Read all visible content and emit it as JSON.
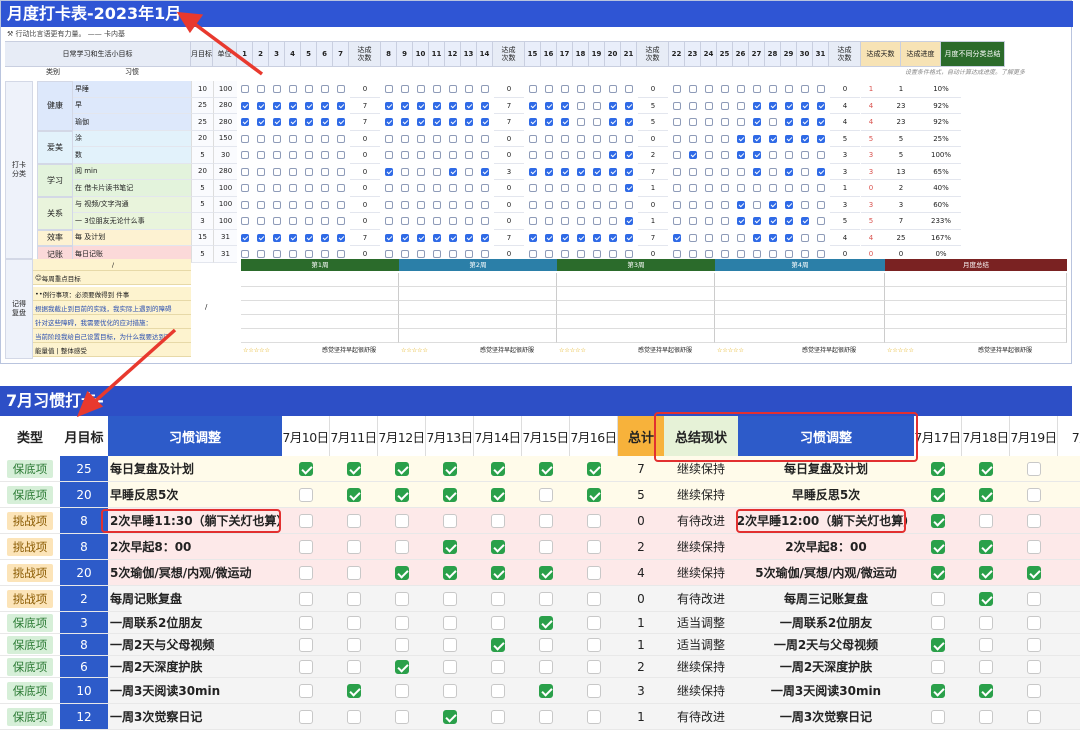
{
  "top": {
    "title": "月度打卡表-2023年1月",
    "quote": "行动比言语更有力量。 —— 卡内基",
    "head": {
      "goal_col": "日常学习和生活小目标",
      "monthly_target": "月目标",
      "done": "单位",
      "reach": "达成\n次数",
      "days_done": "达成天数",
      "progress": "达成进度",
      "summary": "月度不同分类总结"
    },
    "sub": {
      "category": "类别",
      "habit": "习惯",
      "hint": "设置条件格式，自动计算达成进度。了解更多"
    },
    "days": [
      "1",
      "2",
      "3",
      "4",
      "5",
      "6",
      "7",
      "8",
      "9",
      "10",
      "11",
      "12",
      "13",
      "14",
      "15",
      "16",
      "17",
      "18",
      "19",
      "20",
      "21",
      "22",
      "23",
      "24",
      "25",
      "26",
      "27",
      "28",
      "29",
      "30",
      "31"
    ],
    "label_daka": "打卡\n分类",
    "categories": [
      {
        "name": "健康",
        "rows": 3,
        "color": "#dde8fb"
      },
      {
        "name": "爱美",
        "rows": 2,
        "color": "#e2f2fb"
      },
      {
        "name": "学习",
        "rows": 2,
        "color": "#e3f3dc"
      },
      {
        "name": "关系",
        "rows": 2,
        "color": "#e9f4dc"
      },
      {
        "name": "效率",
        "rows": 1,
        "color": "#fdf2d2"
      },
      {
        "name": "记账",
        "rows": 1,
        "color": "#fbd9d9"
      }
    ],
    "rows": [
      {
        "habit": "早睡",
        "n1": "10",
        "n2": "100",
        "w": [
          "0",
          "0",
          "0",
          "0"
        ],
        "r": "1",
        "t": "1",
        "p": "10%",
        "checks": "0000000 0000000 0000000 0000000000"
      },
      {
        "habit": "早",
        "n1": "25",
        "n2": "280",
        "w": [
          "7",
          "7",
          "5",
          "4"
        ],
        "r": "4",
        "t": "23",
        "p": "92%",
        "checks": "1111111 1111111 1110011 0000011111"
      },
      {
        "habit": "瑜伽",
        "n1": "25",
        "n2": "280",
        "w": [
          "7",
          "7",
          "5",
          "4"
        ],
        "r": "4",
        "t": "23",
        "p": "92%",
        "checks": "1111111 1111111 1110011 0000010111"
      },
      {
        "habit": "涂",
        "n1": "20",
        "n2": "150",
        "w": [
          "0",
          "0",
          "0",
          "5"
        ],
        "r": "5",
        "t": "5",
        "p": "25%",
        "checks": "0000000 0000000 0000000 0000111111"
      },
      {
        "habit": "数",
        "n1": "5",
        "n2": "30",
        "w": [
          "0",
          "0",
          "2",
          "3"
        ],
        "r": "3",
        "t": "5",
        "p": "100%",
        "checks": "0000000 0000000 0000011 0100110000"
      },
      {
        "habit": "阅 min",
        "n1": "20",
        "n2": "280",
        "w": [
          "0",
          "3",
          "7",
          "3"
        ],
        "r": "3",
        "t": "13",
        "p": "65%",
        "checks": "0000000 1000101 1111111 0000010101"
      },
      {
        "habit": "在 借卡片读书笔记",
        "n1": "5",
        "n2": "100",
        "w": [
          "0",
          "0",
          "1",
          "1"
        ],
        "r": "0",
        "t": "2",
        "p": "40%",
        "checks": "0000000 0000000 0000001 0000000000"
      },
      {
        "habit": "与 视频/文字沟通",
        "n1": "5",
        "n2": "100",
        "w": [
          "0",
          "0",
          "0",
          "3"
        ],
        "r": "3",
        "t": "3",
        "p": "60%",
        "checks": "0000000 0000000 0000000 0000101100"
      },
      {
        "habit": "一 3位朋友无论什么事",
        "n1": "3",
        "n2": "100",
        "w": [
          "0",
          "0",
          "1",
          "5"
        ],
        "r": "5",
        "t": "7",
        "p": "233%",
        "checks": "0000000 0000000 0000001 0000111110"
      },
      {
        "habit": "每 及计划",
        "n1": "15",
        "n2": "31",
        "w": [
          "7",
          "7",
          "7",
          "4"
        ],
        "r": "4",
        "t": "25",
        "p": "167%",
        "checks": "1111111 1111111 1111111 1000011100"
      },
      {
        "habit": "每日记账",
        "n1": "5",
        "n2": "31",
        "w": [
          "0",
          "0",
          "0",
          "0"
        ],
        "r": "0",
        "t": "0",
        "p": "0%",
        "checks": "0000000 0000000 0000000 0000000000"
      }
    ],
    "review": {
      "label": "记得\n复盘",
      "slash": "/",
      "slash2": "/",
      "lines": [
        "每周重点目标",
        "例行事项：必须要做得到 件事",
        "根据我截止到目前的实践，我实际上遇到的障碍",
        "针对这些障碍，我需要优化的应对措施：",
        "当前阶段我给自己设置目标，为什么我要达到？",
        "能量值 | 整体感受"
      ],
      "weeks": [
        "第1周",
        "第2周",
        "第3周",
        "第4周",
        "月度总结"
      ],
      "week_colors": [
        "#2b6b2b",
        "#2b7fa8",
        "#2b6b2b",
        "#2b7fa8",
        "#7a2222"
      ],
      "foot": "感觉坚持早起很舒服",
      "stars": "☆☆☆☆☆"
    }
  },
  "bottom": {
    "title": "7月习惯打卡-",
    "headers": {
      "type": "类型",
      "target": "月目标",
      "habit": "习惯调整",
      "total": "总计",
      "status": "总结现状",
      "habit2": "习惯调整"
    },
    "dates1": [
      "7月10日",
      "7月11日",
      "7月12日",
      "7月13日",
      "7月14日",
      "7月15日",
      "7月16日"
    ],
    "dates2": [
      "7月17日",
      "7月18日",
      "7月19日",
      "7月"
    ],
    "colors": {
      "tag_keep_bg": "#d6efd8",
      "tag_keep_fg": "#2a7a33",
      "tag_chal_bg": "#fce4b8",
      "tag_chal_fg": "#8a5a00",
      "target_bg": "#2d5bc9",
      "header_blue": "#2d5bc9",
      "total_orange": "#f7b23b",
      "red": "#e23030"
    },
    "rows": [
      {
        "type": "保底项",
        "kind": "keep",
        "target": "25",
        "habit": "每日复盘及计划",
        "checks": "1111111",
        "total": "7",
        "status": "继续保持",
        "habit2": "每日复盘及计划",
        "checks2": "110",
        "bg": "#fffbea"
      },
      {
        "type": "保底项",
        "kind": "keep",
        "target": "20",
        "habit": "早睡反思5次",
        "checks": "0111101",
        "total": "5",
        "status": "继续保持",
        "habit2": "早睡反思5次",
        "checks2": "110",
        "bg": "#fffbea"
      },
      {
        "type": "挑战项",
        "kind": "chal",
        "target": "8",
        "habit": "2次早睡11:30（躺下关灯也算）",
        "checks": "0000000",
        "total": "0",
        "status": "有待改进",
        "habit2": "2次早睡12:00（躺下关灯也算）",
        "checks2": "100",
        "bg": "#fde9e9"
      },
      {
        "type": "挑战项",
        "kind": "chal",
        "target": "8",
        "habit": "2次早起8：00",
        "checks": "0001100",
        "total": "2",
        "status": "继续保持",
        "habit2": "2次早起8：00",
        "checks2": "110",
        "bg": "#fde9e9"
      },
      {
        "type": "挑战项",
        "kind": "chal",
        "target": "20",
        "habit": "5次瑜伽/冥想/内观/微运动",
        "checks": "0011110",
        "total": "4",
        "status": "继续保持",
        "habit2": "5次瑜伽/冥想/内观/微运动",
        "checks2": "111",
        "bg": "#fde9e9"
      },
      {
        "type": "挑战项",
        "kind": "chal",
        "target": "2",
        "habit": "每周记账复盘",
        "checks": "0000000",
        "total": "0",
        "status": "有待改进",
        "habit2": "每周三记账复盘",
        "checks2": "010",
        "bg": "#f4f4f4"
      },
      {
        "type": "保底项",
        "kind": "keep",
        "target": "3",
        "habit": "一周联系2位朋友",
        "checks": "0000010",
        "total": "1",
        "status": "适当调整",
        "habit2": "一周联系2位朋友",
        "checks2": "000",
        "bg": "#f4f4f4"
      },
      {
        "type": "保底项",
        "kind": "keep",
        "target": "8",
        "habit": "一周2天与父母视频",
        "checks": "0000100",
        "total": "1",
        "status": "适当调整",
        "habit2": "一周2天与父母视频",
        "checks2": "100",
        "bg": "#f4f4f4"
      },
      {
        "type": "保底项",
        "kind": "keep",
        "target": "6",
        "habit": "一周2天深度护肤",
        "checks": "0010000",
        "total": "2",
        "status": "继续保持",
        "habit2": "一周2天深度护肤",
        "checks2": "000",
        "bg": "#f4f4f4"
      },
      {
        "type": "保底项",
        "kind": "keep",
        "target": "10",
        "habit": "一周3天阅读30min",
        "checks": "0100010",
        "total": "3",
        "status": "继续保持",
        "habit2": "一周3天阅读30min",
        "checks2": "110",
        "bg": "#f4f4f4"
      },
      {
        "type": "保底项",
        "kind": "keep",
        "target": "12",
        "habit": "一周3次觉察日记",
        "checks": "0001000",
        "total": "1",
        "status": "有待改进",
        "habit2": "一周3次觉察日记",
        "checks2": "000",
        "bg": "#f4f4f4"
      }
    ]
  }
}
